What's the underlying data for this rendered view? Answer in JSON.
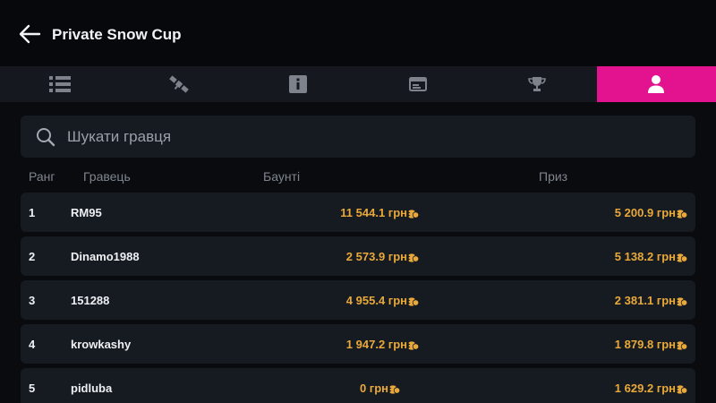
{
  "header": {
    "title": "Private Snow Cup",
    "back_icon": "arrow-left-icon"
  },
  "tabs": [
    {
      "icon": "list-icon",
      "active": false
    },
    {
      "icon": "satellite-icon",
      "active": false
    },
    {
      "icon": "info-icon",
      "active": false
    },
    {
      "icon": "window-icon",
      "active": false
    },
    {
      "icon": "trophy-icon",
      "active": false
    },
    {
      "icon": "user-icon",
      "active": true
    }
  ],
  "search": {
    "placeholder": "Шукати гравця",
    "value": ""
  },
  "columns": {
    "rank": "Ранг",
    "player": "Гравець",
    "bounty": "Баунті",
    "prize": "Приз"
  },
  "players": [
    {
      "rank": "1",
      "name": "RM95",
      "bounty": "11 544.1 грн",
      "prize": "5 200.9 грн"
    },
    {
      "rank": "2",
      "name": "Dinamo1988",
      "bounty": "2 573.9 грн",
      "prize": "5 138.2 грн"
    },
    {
      "rank": "3",
      "name": "151288",
      "bounty": "4 955.4 грн",
      "prize": "2 381.1 грн"
    },
    {
      "rank": "4",
      "name": "krowkashy",
      "bounty": "1 947.2 грн",
      "prize": "1 879.8 грн"
    },
    {
      "rank": "5",
      "name": "pidluba",
      "bounty": "0 грн",
      "prize": "1 629.2 грн"
    }
  ],
  "colors": {
    "accent": "#e3138f",
    "money": "#e9a93a",
    "background": "#090b0e",
    "row": "#161a21"
  }
}
